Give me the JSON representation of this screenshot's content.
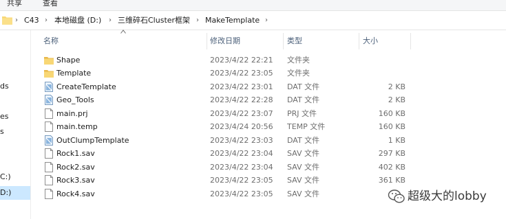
{
  "ribbon": {
    "tabs": [
      "共享",
      "查看"
    ]
  },
  "address": {
    "crumbs": [
      "C43",
      "本地磁盘 (D:)",
      "三维碎石Cluster框架",
      "MakeTemplate"
    ]
  },
  "nav": {
    "items": [
      "ds",
      "es",
      "s",
      "C:)",
      "D:)"
    ]
  },
  "columns": {
    "name": "名称",
    "date": "修改日期",
    "type": "类型",
    "size": "大小"
  },
  "files": [
    {
      "icon": "folder-icon",
      "name": "Shape",
      "date": "2023/4/22 22:21",
      "type": "文件夹",
      "size": ""
    },
    {
      "icon": "folder-icon",
      "name": "Template",
      "date": "2023/4/22 23:05",
      "type": "文件夹",
      "size": ""
    },
    {
      "icon": "dat-file-icon",
      "name": "CreateTemplate",
      "date": "2023/4/22 23:01",
      "type": "DAT 文件",
      "size": "2 KB"
    },
    {
      "icon": "dat-file-icon",
      "name": "Geo_Tools",
      "date": "2023/4/22 22:28",
      "type": "DAT 文件",
      "size": "2 KB"
    },
    {
      "icon": "file-icon",
      "name": "main.prj",
      "date": "2023/4/22 23:07",
      "type": "PRJ 文件",
      "size": "160 KB"
    },
    {
      "icon": "file-icon",
      "name": "main.temp",
      "date": "2023/4/24 20:56",
      "type": "TEMP 文件",
      "size": "160 KB"
    },
    {
      "icon": "dat-file-icon",
      "name": "OutClumpTemplate",
      "date": "2023/4/22 23:03",
      "type": "DAT 文件",
      "size": "1 KB"
    },
    {
      "icon": "file-icon",
      "name": "Rock1.sav",
      "date": "2023/4/22 23:04",
      "type": "SAV 文件",
      "size": "297 KB"
    },
    {
      "icon": "file-icon",
      "name": "Rock2.sav",
      "date": "2023/4/22 23:04",
      "type": "SAV 文件",
      "size": "402 KB"
    },
    {
      "icon": "file-icon",
      "name": "Rock3.sav",
      "date": "2023/4/22 23:05",
      "type": "SAV 文件",
      "size": "361 KB"
    },
    {
      "icon": "file-icon",
      "name": "Rock4.sav",
      "date": "2023/4/22 23:05",
      "type": "SAV 文件",
      "size": ""
    }
  ],
  "watermark": {
    "text": "超级大的lobby"
  },
  "colors": {
    "folder": "#f8d775",
    "selection": "#cce8ff",
    "header_text": "#4c607a"
  }
}
